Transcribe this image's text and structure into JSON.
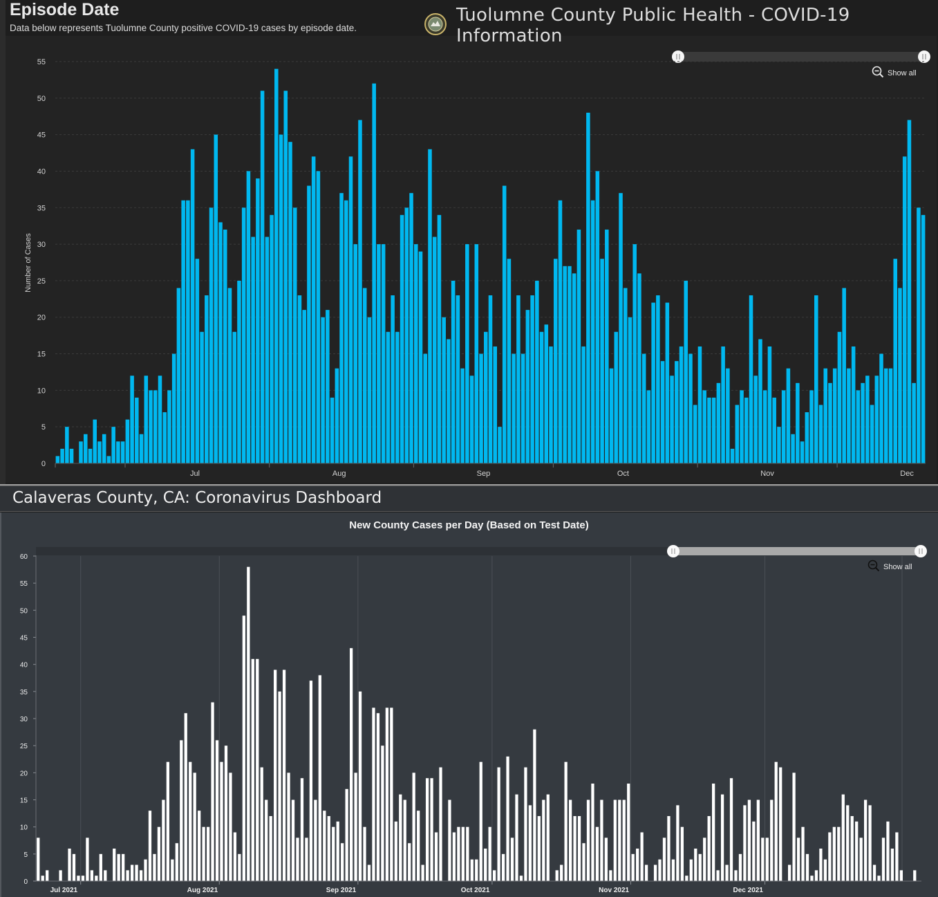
{
  "top": {
    "title": "Episode Date",
    "subtitle": "Data below represents Tuolumne County positive COVID-19 cases by episode date.",
    "brand_title": "Tuolumne County Public Health - COVID-19 Information",
    "show_all_label": "Show all",
    "y_axis_label": "Number of Cases"
  },
  "calaveras": {
    "title": "Calaveras County, CA: Coronavirus Dashboard",
    "chart_title": "New County Cases per Day (Based on Test Date)",
    "show_all_label": "Show all"
  },
  "colors": {
    "top_bar": "#00b8f0",
    "bottom_bar": "#ffffff",
    "top_bg": "#232323",
    "bottom_bg": "#353a40"
  },
  "icons": [
    "county-seal-icon",
    "zoom-out-icon",
    "range-slider-handle-icon"
  ],
  "chart_data": [
    {
      "type": "bar",
      "title": "Episode Date",
      "ylabel": "Number of Cases",
      "xlabel": "",
      "x_tick_labels": [
        "Jul",
        "Aug",
        "Sep",
        "Oct",
        "Nov",
        "Dec"
      ],
      "x_range": [
        "2021-06-16",
        "2021-12-23"
      ],
      "ylim": [
        0,
        55
      ],
      "y_ticks": [
        0,
        5,
        10,
        15,
        20,
        25,
        30,
        35,
        40,
        45,
        50,
        55
      ],
      "grid": true,
      "series": [
        {
          "start_date": "2021-06-16",
          "values": [
            1,
            2,
            5,
            2,
            0,
            3,
            4,
            2,
            6,
            3,
            4,
            1,
            5,
            3,
            3,
            6,
            12,
            9,
            4,
            12,
            10,
            10,
            12,
            7,
            10,
            15,
            24,
            36,
            36,
            43,
            28,
            18,
            23,
            35,
            45,
            33,
            32,
            24,
            18,
            25,
            35,
            40,
            31,
            39,
            51,
            31,
            34,
            54,
            45,
            51,
            44,
            35,
            23,
            21,
            38,
            42,
            40,
            20,
            21,
            9,
            13,
            37,
            36,
            42,
            30,
            47,
            24,
            20,
            52,
            30,
            30,
            18,
            23,
            18,
            34,
            35,
            37,
            30,
            29,
            15,
            43,
            31,
            34,
            20,
            17,
            25,
            23,
            13,
            30,
            12,
            30,
            15,
            18,
            23,
            16,
            5,
            38,
            28,
            15,
            23,
            15,
            21,
            23,
            25,
            18,
            19,
            16,
            28,
            36,
            27,
            27,
            26,
            32,
            16,
            48,
            36,
            40,
            28,
            32,
            13,
            18,
            37,
            24,
            20,
            30,
            26,
            15,
            10,
            22,
            23,
            14,
            22,
            12,
            14,
            16,
            25,
            15,
            8,
            16,
            10,
            9,
            9,
            11,
            16,
            13,
            2,
            8,
            10,
            9,
            23,
            12,
            17,
            10,
            16,
            9,
            5,
            10,
            13,
            4,
            11,
            3,
            7,
            10,
            23,
            8,
            13,
            11,
            13,
            18,
            24,
            13,
            16,
            10,
            11,
            12,
            8,
            12,
            15,
            13,
            13,
            28,
            24,
            42,
            47,
            11,
            35,
            34
          ]
        }
      ]
    },
    {
      "type": "bar",
      "title": "New County Cases per Day (Based on Test Date)",
      "xlabel": "",
      "ylabel": "",
      "x_tick_labels": [
        "Jul 2021",
        "Aug 2021",
        "Sep 2021",
        "Oct 2021",
        "Nov 2021",
        "Dec 2021"
      ],
      "x_range": [
        "2021-06-21",
        "2021-12-23"
      ],
      "ylim": [
        0,
        60
      ],
      "y_ticks": [
        0,
        5,
        10,
        15,
        20,
        25,
        30,
        35,
        40,
        45,
        50,
        55,
        60
      ],
      "grid": true,
      "series": [
        {
          "start_date": "2021-06-21",
          "values": [
            8,
            1,
            2,
            0,
            0,
            2,
            0,
            6,
            5,
            1,
            1,
            8,
            2,
            1,
            5,
            2,
            0,
            6,
            5,
            5,
            2,
            3,
            3,
            2,
            4,
            13,
            5,
            10,
            15,
            22,
            4,
            7,
            26,
            31,
            22,
            20,
            13,
            10,
            10,
            33,
            26,
            22,
            25,
            20,
            9,
            5,
            49,
            58,
            41,
            41,
            21,
            15,
            12,
            39,
            35,
            39,
            20,
            15,
            8,
            19,
            8,
            37,
            15,
            38,
            13,
            12,
            10,
            11,
            7,
            17,
            43,
            20,
            35,
            10,
            3,
            32,
            31,
            25,
            32,
            32,
            11,
            16,
            15,
            7,
            20,
            13,
            3,
            19,
            19,
            9,
            21,
            0,
            15,
            9,
            10,
            10,
            10,
            4,
            4,
            22,
            6,
            10,
            2,
            21,
            5,
            23,
            8,
            16,
            1,
            21,
            14,
            28,
            12,
            15,
            16,
            0,
            2,
            3,
            22,
            15,
            12,
            12,
            7,
            15,
            18,
            10,
            15,
            8,
            2,
            15,
            15,
            15,
            18,
            5,
            6,
            9,
            3,
            0,
            3,
            4,
            8,
            12,
            4,
            14,
            10,
            1,
            4,
            6,
            5,
            8,
            12,
            18,
            2,
            16,
            3,
            19,
            2,
            5,
            14,
            15,
            11,
            15,
            8,
            8,
            15,
            22,
            21,
            0,
            3,
            20,
            8,
            10,
            5,
            1,
            2,
            6,
            4,
            9,
            10,
            10,
            16,
            14,
            12,
            11,
            8,
            15,
            14,
            3,
            1,
            8,
            11,
            6,
            9,
            2,
            0,
            0,
            2,
            0
          ]
        }
      ]
    }
  ]
}
